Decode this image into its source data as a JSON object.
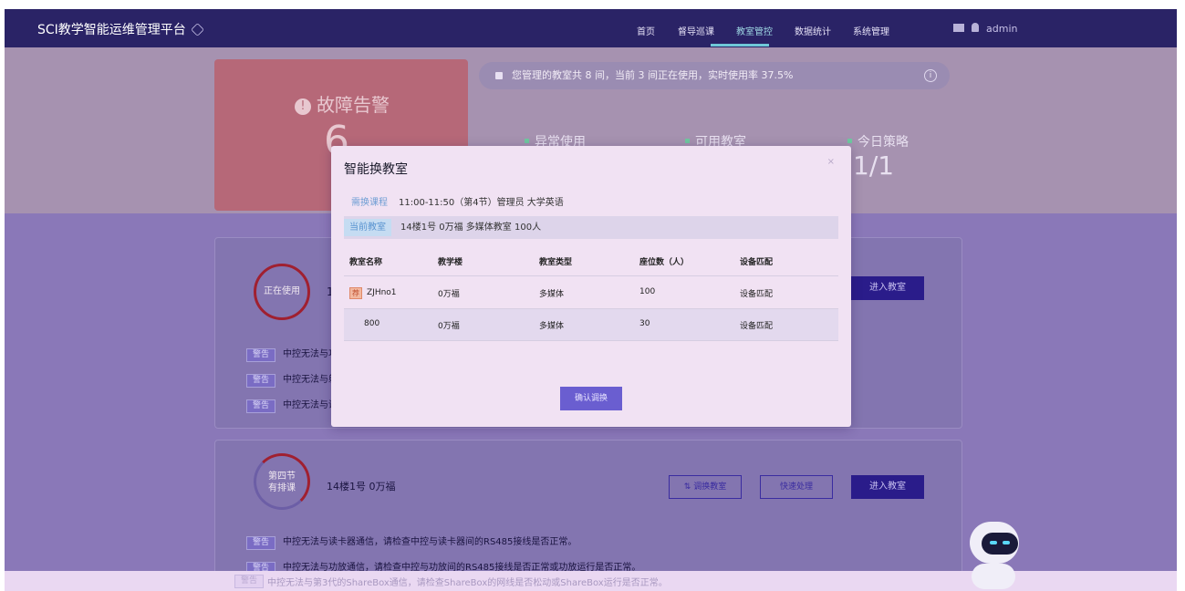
{
  "app": {
    "title": "SCI教学智能运维管理平台"
  },
  "nav": {
    "items": [
      {
        "label": "首页",
        "active": false
      },
      {
        "label": "督导巡课",
        "active": false
      },
      {
        "label": "教室管控",
        "active": true
      },
      {
        "label": "数据统计",
        "active": false
      },
      {
        "label": "系统管理",
        "active": false
      }
    ],
    "user": "admin"
  },
  "dashboard": {
    "alarm_title": "故障告警",
    "alarm_count": "6",
    "notice": "您管理的教室共 8 间，当前 3 间正在使用，实时使用率 37.5%",
    "stats": [
      {
        "label": "异常使用"
      },
      {
        "label": "可用教室"
      },
      {
        "label": "今日策略",
        "value": "1/1"
      }
    ]
  },
  "panel1": {
    "ring_label": "正在使用",
    "room_partial": "1",
    "enter_btn": "进入教室",
    "messages": [
      {
        "tag": "警告",
        "text": "中控无法与功"
      },
      {
        "tag": "警告",
        "text": "中控无法与射"
      },
      {
        "tag": "警告",
        "text": "中控无法与讲"
      }
    ]
  },
  "panel2": {
    "ring_line1": "第四节",
    "ring_line2": "有排课",
    "room": "14楼1号  0万福",
    "swap_btn": "调换教室",
    "quick_btn": "快速处理",
    "enter_btn": "进入教室",
    "messages": [
      {
        "tag": "警告",
        "text": "中控无法与读卡器通信，请检查中控与读卡器间的RS485接线是否正常。"
      },
      {
        "tag": "警告",
        "text": "中控无法与功放通信，请检查中控与功放间的RS485接线是否正常或功放运行是否正常。"
      },
      {
        "tag": "警告",
        "text": "中控无法与第3代的ShareBox通信，请检查ShareBox的网线是否松动或ShareBox运行是否正常。"
      }
    ]
  },
  "modal": {
    "title": "智能换教室",
    "course_label": "需换课程",
    "course_value": "11:00-11:50（第4节）管理员 大学英语",
    "current_label": "当前教室",
    "current_value": "14楼1号  0万福 多媒体教室 100人",
    "columns": [
      "教室名称",
      "教学楼",
      "教室类型",
      "座位数（人）",
      "设备匹配"
    ],
    "rows": [
      {
        "badge": "荐",
        "name": "ZJHno1",
        "building": "0万福",
        "type": "多媒体",
        "seats": "100",
        "match": "设备匹配"
      },
      {
        "badge": "",
        "name": "800",
        "building": "0万福",
        "type": "多媒体",
        "seats": "30",
        "match": "设备匹配"
      }
    ],
    "confirm": "确认调换"
  }
}
